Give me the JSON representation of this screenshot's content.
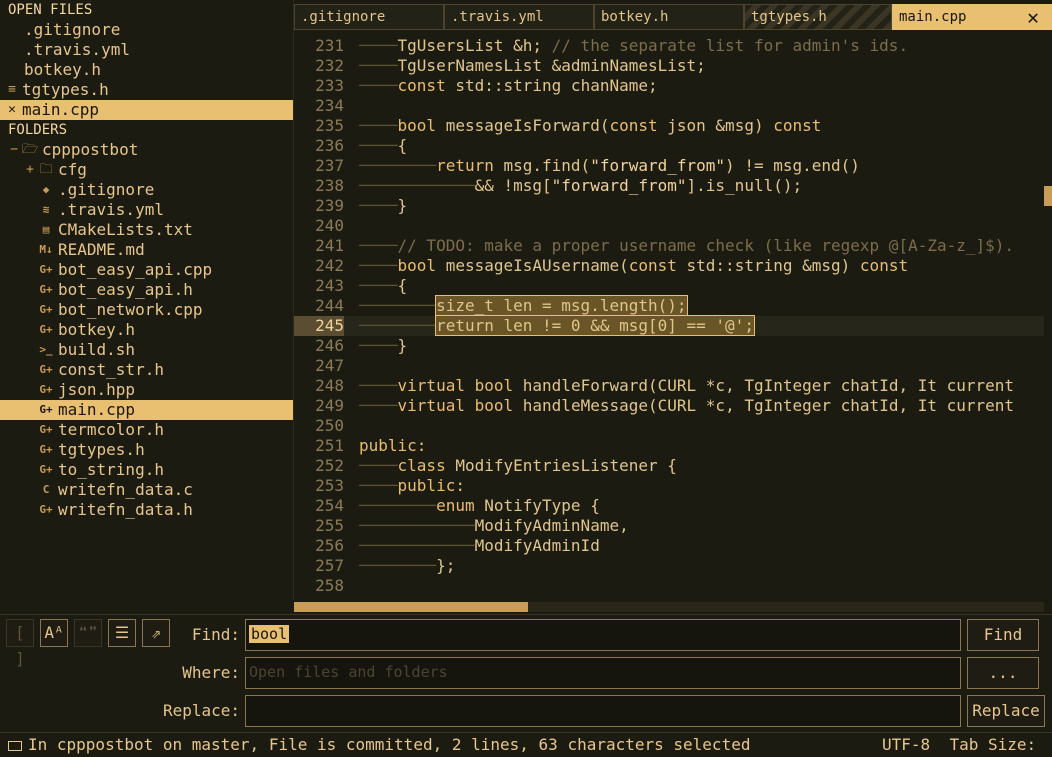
{
  "sidebar": {
    "open_files_header": "OPEN FILES",
    "open_files": [
      {
        "label": ".gitignore",
        "icon": "none",
        "active": false
      },
      {
        "label": ".travis.yml",
        "icon": "none",
        "active": false
      },
      {
        "label": "botkey.h",
        "icon": "none",
        "active": false
      },
      {
        "label": "tgtypes.h",
        "icon": "lines-icon",
        "glyph": "≡",
        "active": false
      },
      {
        "label": "main.cpp",
        "icon": "close-icon",
        "glyph": "✕",
        "active": true
      }
    ],
    "folders_header": "FOLDERS",
    "root_folder": {
      "label": "cpppostbot",
      "toggle": "−",
      "icon": "folder-open-icon",
      "glyph": "🗁"
    },
    "sub_folder": {
      "label": "cfg",
      "toggle": "+",
      "icon": "folder-icon",
      "glyph": "🗀"
    },
    "files": [
      {
        "label": ".gitignore",
        "icon": "git-icon",
        "glyph": "◆"
      },
      {
        "label": ".travis.yml",
        "icon": "database-icon",
        "glyph": "≋"
      },
      {
        "label": "CMakeLists.txt",
        "icon": "document-icon",
        "glyph": "▤"
      },
      {
        "label": "README.md",
        "icon": "markdown-icon",
        "glyph": "M↓"
      },
      {
        "label": "bot_easy_api.cpp",
        "icon": "cpp-icon",
        "glyph": "G+"
      },
      {
        "label": "bot_easy_api.h",
        "icon": "cpp-icon",
        "glyph": "G+"
      },
      {
        "label": "bot_network.cpp",
        "icon": "cpp-icon",
        "glyph": "G+"
      },
      {
        "label": "botkey.h",
        "icon": "cpp-icon",
        "glyph": "G+"
      },
      {
        "label": "build.sh",
        "icon": "terminal-icon",
        "glyph": ">_"
      },
      {
        "label": "const_str.h",
        "icon": "cpp-icon",
        "glyph": "G+"
      },
      {
        "label": "json.hpp",
        "icon": "cpp-icon",
        "glyph": "G+"
      },
      {
        "label": "main.cpp",
        "icon": "cpp-icon",
        "glyph": "G+",
        "active": true
      },
      {
        "label": "termcolor.h",
        "icon": "cpp-icon",
        "glyph": "G+"
      },
      {
        "label": "tgtypes.h",
        "icon": "cpp-icon",
        "glyph": "G+"
      },
      {
        "label": "to_string.h",
        "icon": "cpp-icon",
        "glyph": "G+"
      },
      {
        "label": "writefn_data.c",
        "icon": "c-icon",
        "glyph": "C"
      },
      {
        "label": "writefn_data.h",
        "icon": "cpp-icon",
        "glyph": "G+"
      }
    ]
  },
  "tabs": [
    {
      "label": ".gitignore",
      "active": false,
      "striped": false
    },
    {
      "label": ".travis.yml",
      "active": false,
      "striped": false
    },
    {
      "label": "botkey.h",
      "active": false,
      "striped": false
    },
    {
      "label": "tgtypes.h",
      "active": false,
      "striped": true
    },
    {
      "label": "main.cpp",
      "active": true,
      "striped": false
    }
  ],
  "tab_close_glyph": "✕",
  "editor": {
    "current_line": "245",
    "lines": [
      {
        "n": "231",
        "indent": 1,
        "segs": [
          [
            "TgUsersList &h; ",
            ""
          ],
          [
            "// the separate list for admin's ids.",
            "cm"
          ]
        ]
      },
      {
        "n": "232",
        "indent": 1,
        "segs": [
          [
            "TgUserNamesList &adminNamesList;",
            ""
          ]
        ]
      },
      {
        "n": "233",
        "indent": 1,
        "segs": [
          [
            "const",
            "kw"
          ],
          [
            " std::string chanName;",
            ""
          ]
        ]
      },
      {
        "n": "234",
        "indent": 0,
        "segs": []
      },
      {
        "n": "235",
        "indent": 1,
        "segs": [
          [
            "bool",
            "kw"
          ],
          [
            " messageIsForward(",
            ""
          ],
          [
            "const",
            "kw"
          ],
          [
            " json &msg) ",
            ""
          ],
          [
            "const",
            "kw"
          ]
        ]
      },
      {
        "n": "236",
        "indent": 1,
        "segs": [
          [
            "{",
            ""
          ]
        ]
      },
      {
        "n": "237",
        "indent": 2,
        "segs": [
          [
            "return",
            "kw"
          ],
          [
            " msg.find(",
            ""
          ],
          [
            "\"forward_from\"",
            "st"
          ],
          [
            ") != msg.end()",
            ""
          ]
        ]
      },
      {
        "n": "238",
        "indent": 3,
        "segs": [
          [
            "&& !msg[",
            ""
          ],
          [
            "\"forward_from\"",
            "st"
          ],
          [
            "].is_null();",
            ""
          ]
        ]
      },
      {
        "n": "239",
        "indent": 1,
        "segs": [
          [
            "}",
            ""
          ]
        ]
      },
      {
        "n": "240",
        "indent": 0,
        "segs": []
      },
      {
        "n": "241",
        "indent": 1,
        "segs": [
          [
            "// TODO: make a proper username check (like regexp @[A-Za-z_]$).",
            "cm"
          ]
        ]
      },
      {
        "n": "242",
        "indent": 1,
        "segs": [
          [
            "bool",
            "kw"
          ],
          [
            " messageIsAUsername(",
            ""
          ],
          [
            "const",
            "kw"
          ],
          [
            " std::string &msg) ",
            ""
          ],
          [
            "const",
            "kw"
          ]
        ]
      },
      {
        "n": "243",
        "indent": 1,
        "segs": [
          [
            "{",
            ""
          ]
        ]
      },
      {
        "n": "244",
        "indent": 2,
        "segs": [
          [
            "size_t len = msg.length();",
            "hl"
          ]
        ]
      },
      {
        "n": "245",
        "indent": 2,
        "segs": [
          [
            "return len != 0 && msg[0] == '@';",
            "hl"
          ]
        ]
      },
      {
        "n": "246",
        "indent": 1,
        "segs": [
          [
            "}",
            ""
          ]
        ]
      },
      {
        "n": "247",
        "indent": 0,
        "segs": []
      },
      {
        "n": "248",
        "indent": 1,
        "segs": [
          [
            "virtual",
            "kw"
          ],
          [
            " ",
            ""
          ],
          [
            "bool",
            "kw"
          ],
          [
            " handleForward(CURL *c, TgInteger chatId, It current",
            ""
          ]
        ]
      },
      {
        "n": "249",
        "indent": 1,
        "segs": [
          [
            "virtual",
            "kw"
          ],
          [
            " ",
            ""
          ],
          [
            "bool",
            "kw"
          ],
          [
            " handleMessage(CURL *c, TgInteger chatId, It current",
            ""
          ]
        ]
      },
      {
        "n": "250",
        "indent": 0,
        "segs": []
      },
      {
        "n": "251",
        "indent": 0,
        "segs": [
          [
            "public",
            "kw"
          ],
          [
            ":",
            ""
          ]
        ]
      },
      {
        "n": "252",
        "indent": 1,
        "segs": [
          [
            "class",
            "kw"
          ],
          [
            " ModifyEntriesListener {",
            ""
          ]
        ]
      },
      {
        "n": "253",
        "indent": 1,
        "segs": [
          [
            "public",
            "kw"
          ],
          [
            ":",
            ""
          ]
        ]
      },
      {
        "n": "254",
        "indent": 2,
        "segs": [
          [
            "enum",
            "kw"
          ],
          [
            " NotifyType {",
            ""
          ]
        ]
      },
      {
        "n": "255",
        "indent": 3,
        "segs": [
          [
            "ModifyAdminName,",
            ""
          ]
        ]
      },
      {
        "n": "256",
        "indent": 3,
        "segs": [
          [
            "ModifyAdminId",
            ""
          ]
        ]
      },
      {
        "n": "257",
        "indent": 2,
        "segs": [
          [
            "};",
            ""
          ]
        ]
      },
      {
        "n": "258",
        "indent": 0,
        "segs": []
      }
    ]
  },
  "find_panel": {
    "toggles": [
      {
        "name": "regex-toggle",
        "glyph": "[ ]",
        "on": false
      },
      {
        "name": "case-sensitive-toggle",
        "glyph": "Aᴬ",
        "on": true
      },
      {
        "name": "whole-word-toggle",
        "glyph": "❝❞",
        "on": false
      },
      {
        "name": "show-context-toggle",
        "glyph": "☰",
        "on": true
      },
      {
        "name": "use-buffer-toggle",
        "glyph": "⇗",
        "on": true
      }
    ],
    "find_label": "Find:",
    "find_value": "bool",
    "where_label": "Where:",
    "where_placeholder": "Open files and folders",
    "replace_label": "Replace:",
    "replace_value": "",
    "find_button": "Find",
    "where_button": "...",
    "replace_button": "Replace"
  },
  "status": {
    "left": "In cpppostbot on master, File is committed, 2 lines, 63 characters selected",
    "encoding": "UTF-8",
    "tab_size": "Tab Size:"
  },
  "colors": {
    "background": "#1b1b12",
    "accent": "#e9bf71",
    "text": "#e0c58c",
    "comment": "#7c6c4a"
  }
}
